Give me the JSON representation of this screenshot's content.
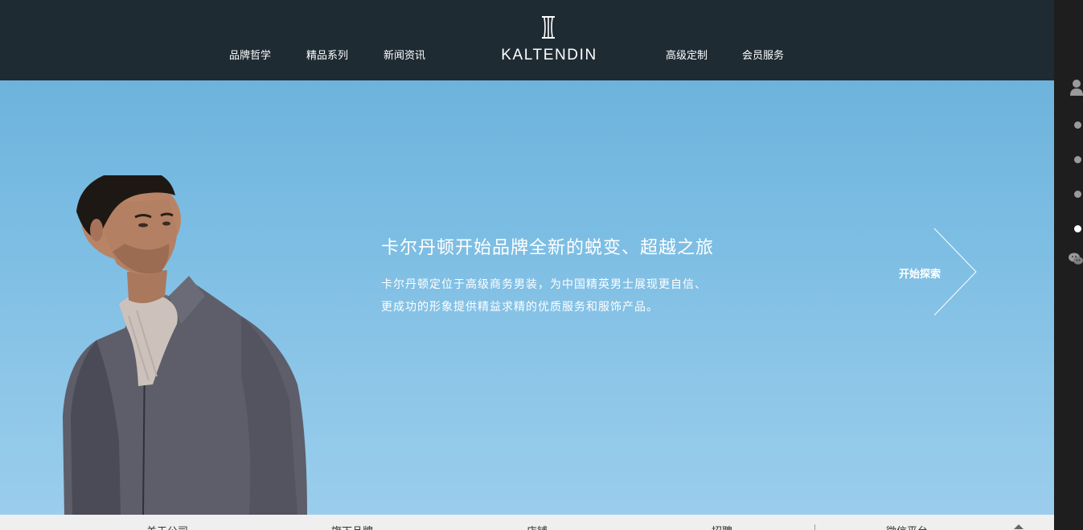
{
  "header": {
    "nav_left": [
      "品牌哲学",
      "精品系列",
      "新闻资讯"
    ],
    "brand": "KALTENDIN",
    "nav_right": [
      "高级定制",
      "会员服务"
    ]
  },
  "hero": {
    "title": "卡尔丹顿开始品牌全新的蜕变、超越之旅",
    "description": [
      "卡尔丹顿定位于高级商务男装，为中国精英男士展现更自信、",
      "更成功的形象提供精益求精的优质服务和服饰产品。"
    ],
    "cta": "开始探索"
  },
  "footer": {
    "items": [
      "关于公司",
      "旗下品牌",
      "店铺",
      "招聘",
      "微信平台"
    ]
  },
  "sidebar": {
    "icons": [
      "user-icon",
      "slide-dot",
      "slide-dot",
      "slide-dot",
      "slide-dot",
      "wechat-icon"
    ],
    "active_dot": 4
  },
  "colors": {
    "header_bg": "#1f2b33",
    "sky": "#7cbde3",
    "sidebar_bg": "#1e1e1e",
    "footer_bg": "#efefef"
  }
}
